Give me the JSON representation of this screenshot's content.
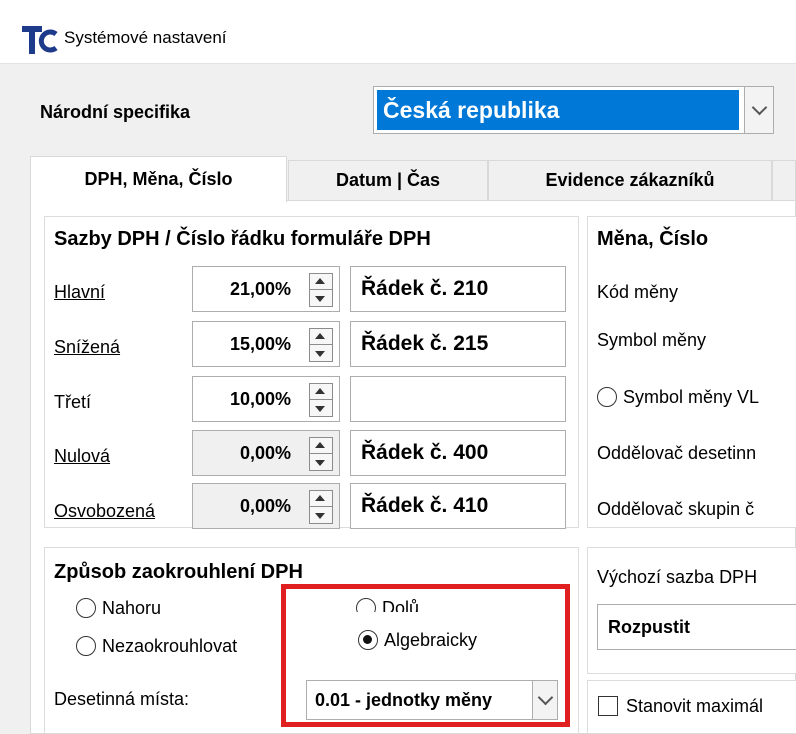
{
  "window": {
    "title": "Systémové nastavení"
  },
  "national": {
    "label": "Národní specifika",
    "value": "Česká republika"
  },
  "tabs": [
    {
      "label": "DPH, Měna, Číslo",
      "active": true
    },
    {
      "label": "Datum | Čas",
      "active": false
    },
    {
      "label": "Evidence zákazníků",
      "active": false
    }
  ],
  "vat_group": {
    "title": "Sazby DPH / Číslo řádku formuláře DPH",
    "rows": [
      {
        "label": "Hlavní",
        "rate": "21,00%",
        "line": "Řádek č. 210",
        "disabled": false
      },
      {
        "label": "Snížená",
        "rate": "15,00%",
        "line": "Řádek č. 215",
        "disabled": false
      },
      {
        "label": "Třetí",
        "rate": "10,00%",
        "line": "",
        "disabled": false
      },
      {
        "label": "Nulová",
        "rate": "0,00%",
        "line": "Řádek č. 400",
        "disabled": true
      },
      {
        "label": "Osvobozená",
        "rate": "0,00%",
        "line": "Řádek č. 410",
        "disabled": true
      }
    ]
  },
  "rounding_group": {
    "title": "Způsob zaokrouhlení DPH",
    "options": {
      "up": "Nahoru",
      "down": "Dolů",
      "none": "Nezaokrouhlovat",
      "algebraic": "Algebraicky"
    },
    "selected": "algebraic",
    "decimals_label": "Desetinná místa:",
    "decimals_value": "0.01 - jednotky měny"
  },
  "currency_group": {
    "title": "Měna, Číslo",
    "currency_code_label": "Kód měny",
    "currency_symbol_label": "Symbol měny",
    "symbol_radio_label": "Symbol měny VL",
    "decimal_sep_label": "Oddělovač desetinn",
    "group_sep_label": "Oddělovač skupin č"
  },
  "default_vat": {
    "label": "Výchozí sazba DPH",
    "value": "Rozpustit"
  },
  "max_checkbox": {
    "label": "Stanovit maximál"
  },
  "colors": {
    "highlight": "#e02020",
    "selection": "#0078d7"
  }
}
